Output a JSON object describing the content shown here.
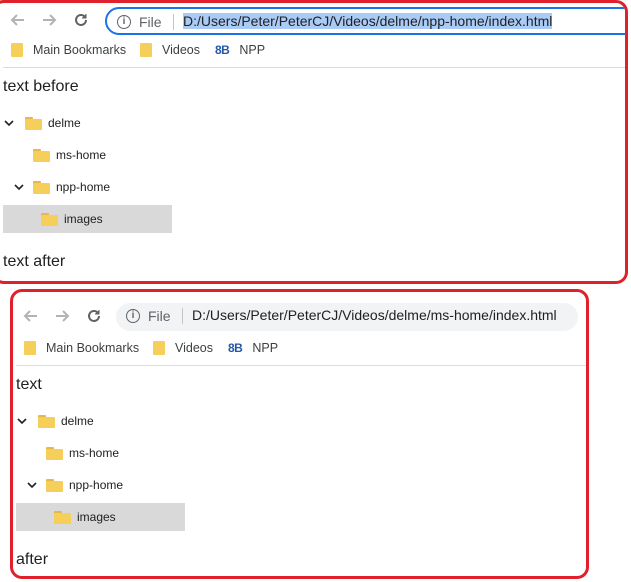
{
  "colors": {
    "frame": "#e0202a",
    "selection": "#aacbf5",
    "selected_row": "#d9d9d9"
  },
  "icons": {
    "back": "arrow-left-icon",
    "forward": "arrow-right-icon",
    "reload": "reload-icon",
    "info": "info-icon",
    "folder": "folder-icon"
  },
  "windows": [
    {
      "omnibox": {
        "scheme": "File",
        "url": "D:/Users/Peter/PeterCJ/Videos/delme/npp-home/index.html",
        "url_selected": true
      },
      "bookmarks": [
        "Main Bookmarks",
        "Videos",
        "NPP"
      ],
      "npp_logo": "8B",
      "text_before": "text before",
      "text_after": "text after",
      "tree": [
        {
          "label": "delme",
          "expanded": true
        },
        {
          "label": "ms-home"
        },
        {
          "label": "npp-home",
          "expanded": true
        },
        {
          "label": "images",
          "selected": true
        }
      ]
    },
    {
      "omnibox": {
        "scheme": "File",
        "url": "D:/Users/Peter/PeterCJ/Videos/delme/ms-home/index.html",
        "url_selected": false
      },
      "bookmarks": [
        "Main Bookmarks",
        "Videos",
        "NPP"
      ],
      "npp_logo": "8B",
      "text_before": "text",
      "text_after": "after",
      "tree": [
        {
          "label": "delme",
          "expanded": true
        },
        {
          "label": "ms-home"
        },
        {
          "label": "npp-home",
          "expanded": true
        },
        {
          "label": "images",
          "selected": true
        }
      ]
    }
  ]
}
